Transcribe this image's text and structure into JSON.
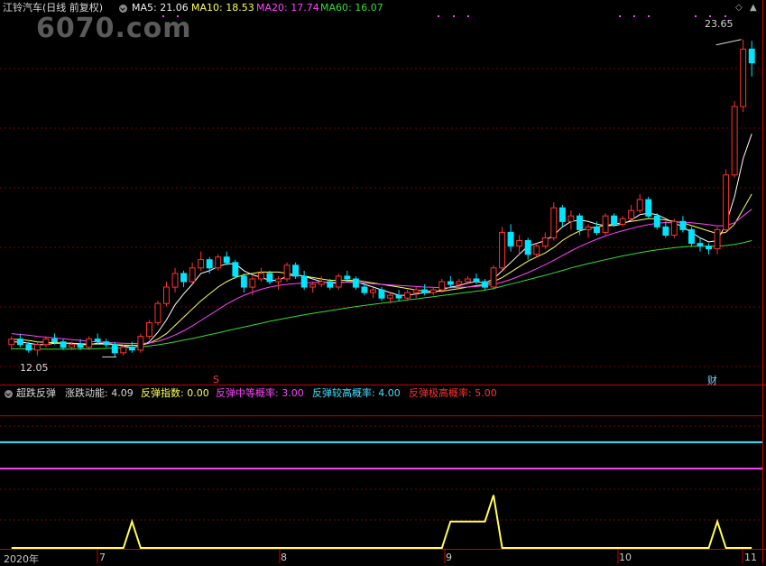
{
  "header": {
    "stock_title": "江铃汽车(日线 前复权)",
    "ma5": "MA5: 21.06",
    "ma10": "MA10: 18.53",
    "ma20": "MA20: 17.74",
    "ma60": "MA60: 16.07"
  },
  "watermark": "6070.com",
  "price_labels": {
    "high": "23.65",
    "low": "12.05"
  },
  "markers": {
    "s_mark": "S",
    "cai_mark": "财"
  },
  "indicator": {
    "name": "超跌反弹",
    "momentum": "涨跌动能: 4.09",
    "rebound_index": "反弹指数: 0.00",
    "medium_prob": "反弹中等概率: 3.00",
    "high_prob": "反弹较高概率: 4.00",
    "extreme_prob": "反弹极高概率: 5.00"
  },
  "time_axis": {
    "year": "2020年",
    "months": [
      "7",
      "8",
      "9",
      "10",
      "11"
    ]
  },
  "colors": {
    "up": "#ff3232",
    "down": "#00e5ff",
    "ma5": "#ffffff",
    "ma10": "#ffff55",
    "ma20": "#ff44ff",
    "ma60": "#33dd33",
    "grid": "#7a0000",
    "sep": "#c80000"
  },
  "chart_data": [
    {
      "type": "candlestick",
      "title": "江铃汽车(日线 前复权)",
      "ylim": [
        11.5,
        24.5
      ],
      "annotations": {
        "high": 23.65,
        "low": 12.05
      },
      "candles": [
        [
          12.5,
          12.8,
          12.3,
          12.7
        ],
        [
          12.7,
          12.9,
          12.4,
          12.5
        ],
        [
          12.5,
          12.6,
          12.2,
          12.3
        ],
        [
          12.3,
          12.6,
          12.1,
          12.5
        ],
        [
          12.5,
          12.8,
          12.4,
          12.7
        ],
        [
          12.7,
          12.9,
          12.5,
          12.6
        ],
        [
          12.6,
          12.7,
          12.3,
          12.4
        ],
        [
          12.4,
          12.6,
          12.3,
          12.5
        ],
        [
          12.5,
          12.7,
          12.3,
          12.4
        ],
        [
          12.4,
          12.8,
          12.3,
          12.7
        ],
        [
          12.7,
          12.9,
          12.5,
          12.6
        ],
        [
          12.6,
          12.7,
          12.4,
          12.5
        ],
        [
          12.5,
          12.6,
          12.05,
          12.2
        ],
        [
          12.2,
          12.5,
          12.1,
          12.4
        ],
        [
          12.4,
          12.6,
          12.2,
          12.3
        ],
        [
          12.3,
          12.9,
          12.2,
          12.8
        ],
        [
          12.8,
          13.4,
          12.7,
          13.3
        ],
        [
          13.3,
          14.1,
          13.2,
          14.0
        ],
        [
          14.0,
          14.8,
          13.9,
          14.6
        ],
        [
          14.6,
          15.3,
          14.4,
          15.1
        ],
        [
          15.1,
          15.2,
          14.6,
          14.8
        ],
        [
          14.8,
          15.5,
          14.7,
          15.3
        ],
        [
          15.3,
          15.9,
          15.2,
          15.6
        ],
        [
          15.6,
          15.7,
          15.1,
          15.3
        ],
        [
          15.3,
          15.8,
          15.2,
          15.7
        ],
        [
          15.7,
          15.9,
          15.4,
          15.5
        ],
        [
          15.5,
          15.6,
          14.9,
          15.0
        ],
        [
          15.0,
          15.1,
          14.4,
          14.6
        ],
        [
          14.6,
          15.0,
          14.3,
          14.9
        ],
        [
          14.9,
          15.3,
          14.8,
          15.1
        ],
        [
          15.1,
          15.2,
          14.7,
          14.8
        ],
        [
          14.8,
          15.0,
          14.5,
          14.9
        ],
        [
          14.9,
          15.5,
          14.8,
          15.4
        ],
        [
          15.4,
          15.5,
          14.9,
          15.0
        ],
        [
          15.0,
          15.2,
          14.5,
          14.6
        ],
        [
          14.6,
          14.8,
          14.4,
          14.7
        ],
        [
          14.7,
          15.0,
          14.6,
          14.8
        ],
        [
          14.8,
          14.9,
          14.5,
          14.6
        ],
        [
          14.6,
          15.1,
          14.5,
          15.0
        ],
        [
          15.0,
          15.2,
          14.8,
          14.9
        ],
        [
          14.9,
          15.0,
          14.5,
          14.6
        ],
        [
          14.6,
          14.7,
          14.3,
          14.4
        ],
        [
          14.4,
          14.6,
          14.2,
          14.5
        ],
        [
          14.5,
          14.6,
          14.1,
          14.2
        ],
        [
          14.2,
          14.4,
          14.0,
          14.3
        ],
        [
          14.3,
          14.5,
          14.1,
          14.2
        ],
        [
          14.2,
          14.5,
          14.1,
          14.4
        ],
        [
          14.4,
          14.6,
          14.2,
          14.5
        ],
        [
          14.5,
          14.7,
          14.3,
          14.4
        ],
        [
          14.4,
          14.6,
          14.3,
          14.5
        ],
        [
          14.5,
          14.9,
          14.4,
          14.8
        ],
        [
          14.8,
          15.0,
          14.6,
          14.7
        ],
        [
          14.7,
          14.9,
          14.5,
          14.8
        ],
        [
          14.8,
          15.0,
          14.7,
          14.9
        ],
        [
          14.9,
          15.1,
          14.7,
          14.8
        ],
        [
          14.8,
          14.9,
          14.5,
          14.6
        ],
        [
          14.6,
          15.4,
          14.5,
          15.3
        ],
        [
          15.3,
          16.8,
          15.2,
          16.6
        ],
        [
          16.6,
          16.9,
          15.9,
          16.1
        ],
        [
          16.1,
          16.5,
          15.8,
          16.3
        ],
        [
          16.3,
          16.4,
          15.6,
          15.8
        ],
        [
          15.8,
          16.2,
          15.7,
          16.1
        ],
        [
          16.1,
          16.6,
          16.0,
          16.4
        ],
        [
          16.4,
          17.7,
          16.3,
          17.5
        ],
        [
          17.5,
          17.6,
          16.8,
          17.0
        ],
        [
          17.0,
          17.4,
          16.7,
          17.2
        ],
        [
          17.2,
          17.3,
          16.5,
          16.7
        ],
        [
          16.7,
          16.9,
          16.4,
          16.8
        ],
        [
          16.8,
          17.0,
          16.5,
          16.6
        ],
        [
          16.6,
          17.3,
          16.5,
          17.2
        ],
        [
          17.2,
          17.3,
          16.8,
          16.9
        ],
        [
          16.9,
          17.2,
          16.8,
          17.1
        ],
        [
          17.1,
          17.6,
          17.0,
          17.4
        ],
        [
          17.4,
          18.0,
          17.3,
          17.8
        ],
        [
          17.8,
          17.9,
          17.1,
          17.2
        ],
        [
          17.2,
          17.3,
          16.7,
          16.8
        ],
        [
          16.8,
          17.0,
          16.4,
          16.5
        ],
        [
          16.5,
          17.1,
          16.4,
          17.0
        ],
        [
          17.0,
          17.2,
          16.6,
          16.7
        ],
        [
          16.7,
          16.8,
          16.1,
          16.2
        ],
        [
          16.2,
          16.4,
          15.9,
          16.1
        ],
        [
          16.1,
          16.2,
          15.8,
          16.0
        ],
        [
          16.0,
          16.8,
          15.8,
          16.7
        ],
        [
          16.7,
          18.9,
          16.6,
          18.7
        ],
        [
          18.7,
          21.4,
          18.6,
          21.2
        ],
        [
          21.2,
          23.65,
          21.0,
          23.3
        ],
        [
          23.3,
          23.6,
          22.3,
          22.8
        ]
      ],
      "series": [
        {
          "name": "MA5",
          "values": [
            12.6,
            12.6,
            12.55,
            12.5,
            12.5,
            12.55,
            12.55,
            12.55,
            12.5,
            12.5,
            12.55,
            12.55,
            12.5,
            12.45,
            12.4,
            12.45,
            12.6,
            12.95,
            13.4,
            13.95,
            14.35,
            14.7,
            15.1,
            15.2,
            15.35,
            15.45,
            15.45,
            15.2,
            15.05,
            14.95,
            14.85,
            14.85,
            15.0,
            15.05,
            15.0,
            14.9,
            14.8,
            14.75,
            14.75,
            14.8,
            14.8,
            14.7,
            14.6,
            14.5,
            14.4,
            14.3,
            14.3,
            14.35,
            14.4,
            14.4,
            14.5,
            14.6,
            14.65,
            14.75,
            14.8,
            14.75,
            14.9,
            15.2,
            15.5,
            15.8,
            16.1,
            16.2,
            16.3,
            16.5,
            16.8,
            17.0,
            17.05,
            17.0,
            16.9,
            16.85,
            16.85,
            16.9,
            17.05,
            17.25,
            17.3,
            17.25,
            17.1,
            16.95,
            16.8,
            16.6,
            16.4,
            16.25,
            16.3,
            16.9,
            17.9,
            19.3,
            20.2
          ]
        },
        {
          "name": "MA10",
          "values": [
            12.7,
            12.68,
            12.65,
            12.6,
            12.58,
            12.57,
            12.56,
            12.55,
            12.53,
            12.52,
            12.52,
            12.52,
            12.5,
            12.48,
            12.47,
            12.48,
            12.55,
            12.7,
            12.9,
            13.2,
            13.5,
            13.8,
            14.1,
            14.35,
            14.6,
            14.8,
            14.95,
            15.05,
            15.1,
            15.15,
            15.15,
            15.15,
            15.1,
            15.05,
            15.0,
            14.95,
            14.9,
            14.85,
            14.85,
            14.85,
            14.85,
            14.8,
            14.75,
            14.7,
            14.65,
            14.6,
            14.55,
            14.5,
            14.45,
            14.45,
            14.45,
            14.5,
            14.55,
            14.6,
            14.65,
            14.7,
            14.8,
            14.95,
            15.15,
            15.35,
            15.55,
            15.7,
            15.85,
            16.05,
            16.3,
            16.5,
            16.65,
            16.75,
            16.8,
            16.85,
            16.9,
            16.95,
            17.0,
            17.05,
            17.1,
            17.1,
            17.05,
            17.0,
            16.95,
            16.85,
            16.75,
            16.65,
            16.55,
            16.6,
            16.9,
            17.45,
            18.0
          ]
        },
        {
          "name": "MA20",
          "values": [
            12.9,
            12.87,
            12.84,
            12.8,
            12.77,
            12.74,
            12.71,
            12.68,
            12.65,
            12.62,
            12.6,
            12.58,
            12.56,
            12.55,
            12.54,
            12.54,
            12.56,
            12.62,
            12.72,
            12.85,
            13.0,
            13.18,
            13.38,
            13.58,
            13.78,
            13.98,
            14.15,
            14.3,
            14.42,
            14.52,
            14.6,
            14.66,
            14.7,
            14.73,
            14.75,
            14.77,
            14.78,
            14.78,
            14.78,
            14.78,
            14.77,
            14.75,
            14.72,
            14.7,
            14.68,
            14.66,
            14.64,
            14.62,
            14.6,
            14.59,
            14.58,
            14.58,
            14.59,
            14.6,
            14.62,
            14.65,
            14.7,
            14.78,
            14.88,
            15.0,
            15.13,
            15.27,
            15.42,
            15.58,
            15.75,
            15.92,
            16.08,
            16.22,
            16.35,
            16.47,
            16.57,
            16.66,
            16.74,
            16.82,
            16.88,
            16.93,
            16.96,
            16.97,
            16.97,
            16.95,
            16.92,
            16.88,
            16.84,
            16.85,
            16.95,
            17.2,
            17.45
          ]
        },
        {
          "name": "MA60",
          "values": [
            12.35,
            12.34,
            12.34,
            12.33,
            12.33,
            12.33,
            12.33,
            12.33,
            12.34,
            12.34,
            12.35,
            12.36,
            12.37,
            12.38,
            12.4,
            12.42,
            12.45,
            12.49,
            12.54,
            12.6,
            12.66,
            12.72,
            12.79,
            12.86,
            12.93,
            13.0,
            13.07,
            13.14,
            13.21,
            13.28,
            13.35,
            13.41,
            13.47,
            13.53,
            13.59,
            13.64,
            13.69,
            13.74,
            13.79,
            13.84,
            13.89,
            13.93,
            13.97,
            14.01,
            14.05,
            14.09,
            14.13,
            14.17,
            14.21,
            14.25,
            14.29,
            14.33,
            14.37,
            14.41,
            14.45,
            14.49,
            14.55,
            14.63,
            14.71,
            14.79,
            14.87,
            14.95,
            15.03,
            15.12,
            15.21,
            15.3,
            15.38,
            15.46,
            15.53,
            15.6,
            15.67,
            15.74,
            15.8,
            15.86,
            15.91,
            15.96,
            16.0,
            16.04,
            16.07,
            16.09,
            16.1,
            16.1,
            16.1,
            16.12,
            16.16,
            16.22,
            16.3
          ]
        }
      ]
    },
    {
      "type": "line",
      "title": "超跌反弹",
      "ylim": [
        0,
        5.5
      ],
      "levels": [
        {
          "name": "反弹中等概率",
          "value": 3.0
        },
        {
          "name": "反弹较高概率",
          "value": 4.0
        },
        {
          "name": "反弹极高概率",
          "value": 5.0
        }
      ],
      "series": [
        {
          "name": "反弹指数",
          "values": [
            0,
            0,
            0,
            0,
            0,
            0,
            0,
            0,
            0,
            0,
            0,
            0,
            0,
            0,
            1,
            0,
            0,
            0,
            0,
            0,
            0,
            0,
            0,
            0,
            0,
            0,
            0,
            0,
            0,
            0,
            0,
            0,
            0,
            0,
            0,
            0,
            0,
            0,
            0,
            0,
            0,
            0,
            0,
            0,
            0,
            0,
            0,
            0,
            0,
            0,
            0,
            1,
            1,
            1,
            1,
            1,
            2,
            0,
            0,
            0,
            0,
            0,
            0,
            0,
            0,
            0,
            0,
            0,
            0,
            0,
            0,
            0,
            0,
            0,
            0,
            0,
            0,
            0,
            0,
            0,
            0,
            0,
            1,
            0,
            0,
            0,
            0
          ]
        }
      ]
    }
  ]
}
